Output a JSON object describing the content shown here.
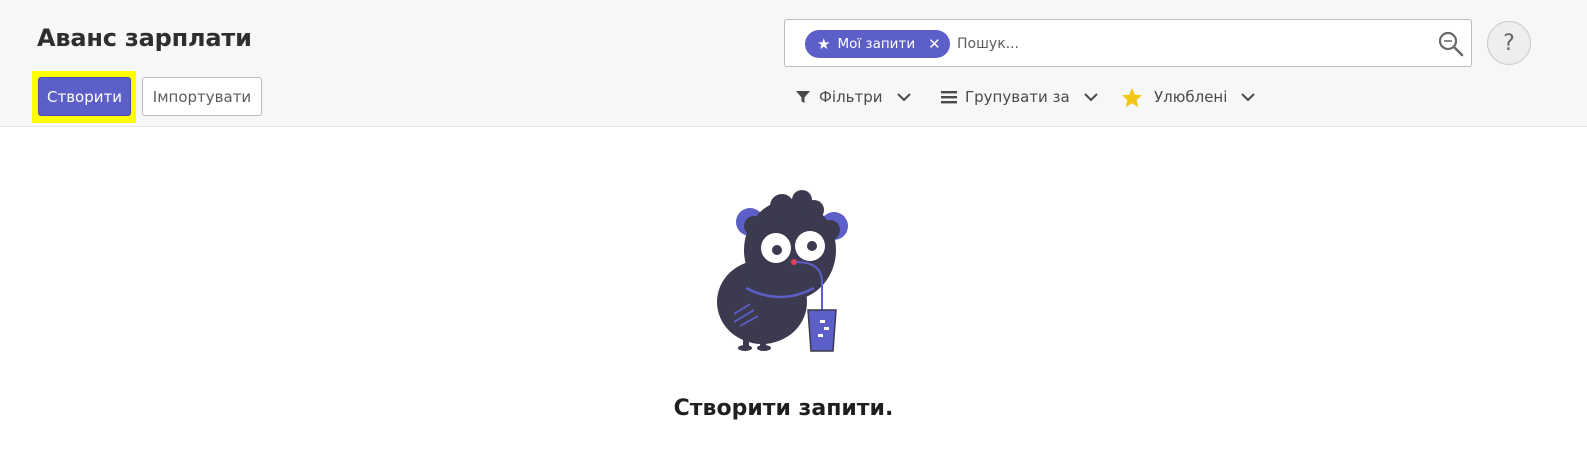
{
  "header": {
    "title": "Аванс зарплати",
    "create_label": "Створити",
    "import_label": "Імпортувати"
  },
  "search": {
    "facet_label": "Мої запити",
    "facet_icon": "star-icon",
    "placeholder": "Пошук...",
    "value": ""
  },
  "toolbar": {
    "filters_label": "Фільтри",
    "group_label": "Групувати за",
    "favorites_label": "Улюблені"
  },
  "help": {
    "label": "?"
  },
  "empty_state": {
    "title": "Створити запити."
  },
  "colors": {
    "primary": "#5b5fc7",
    "highlight": "#ffff00",
    "favorites_star": "#f3c614"
  }
}
